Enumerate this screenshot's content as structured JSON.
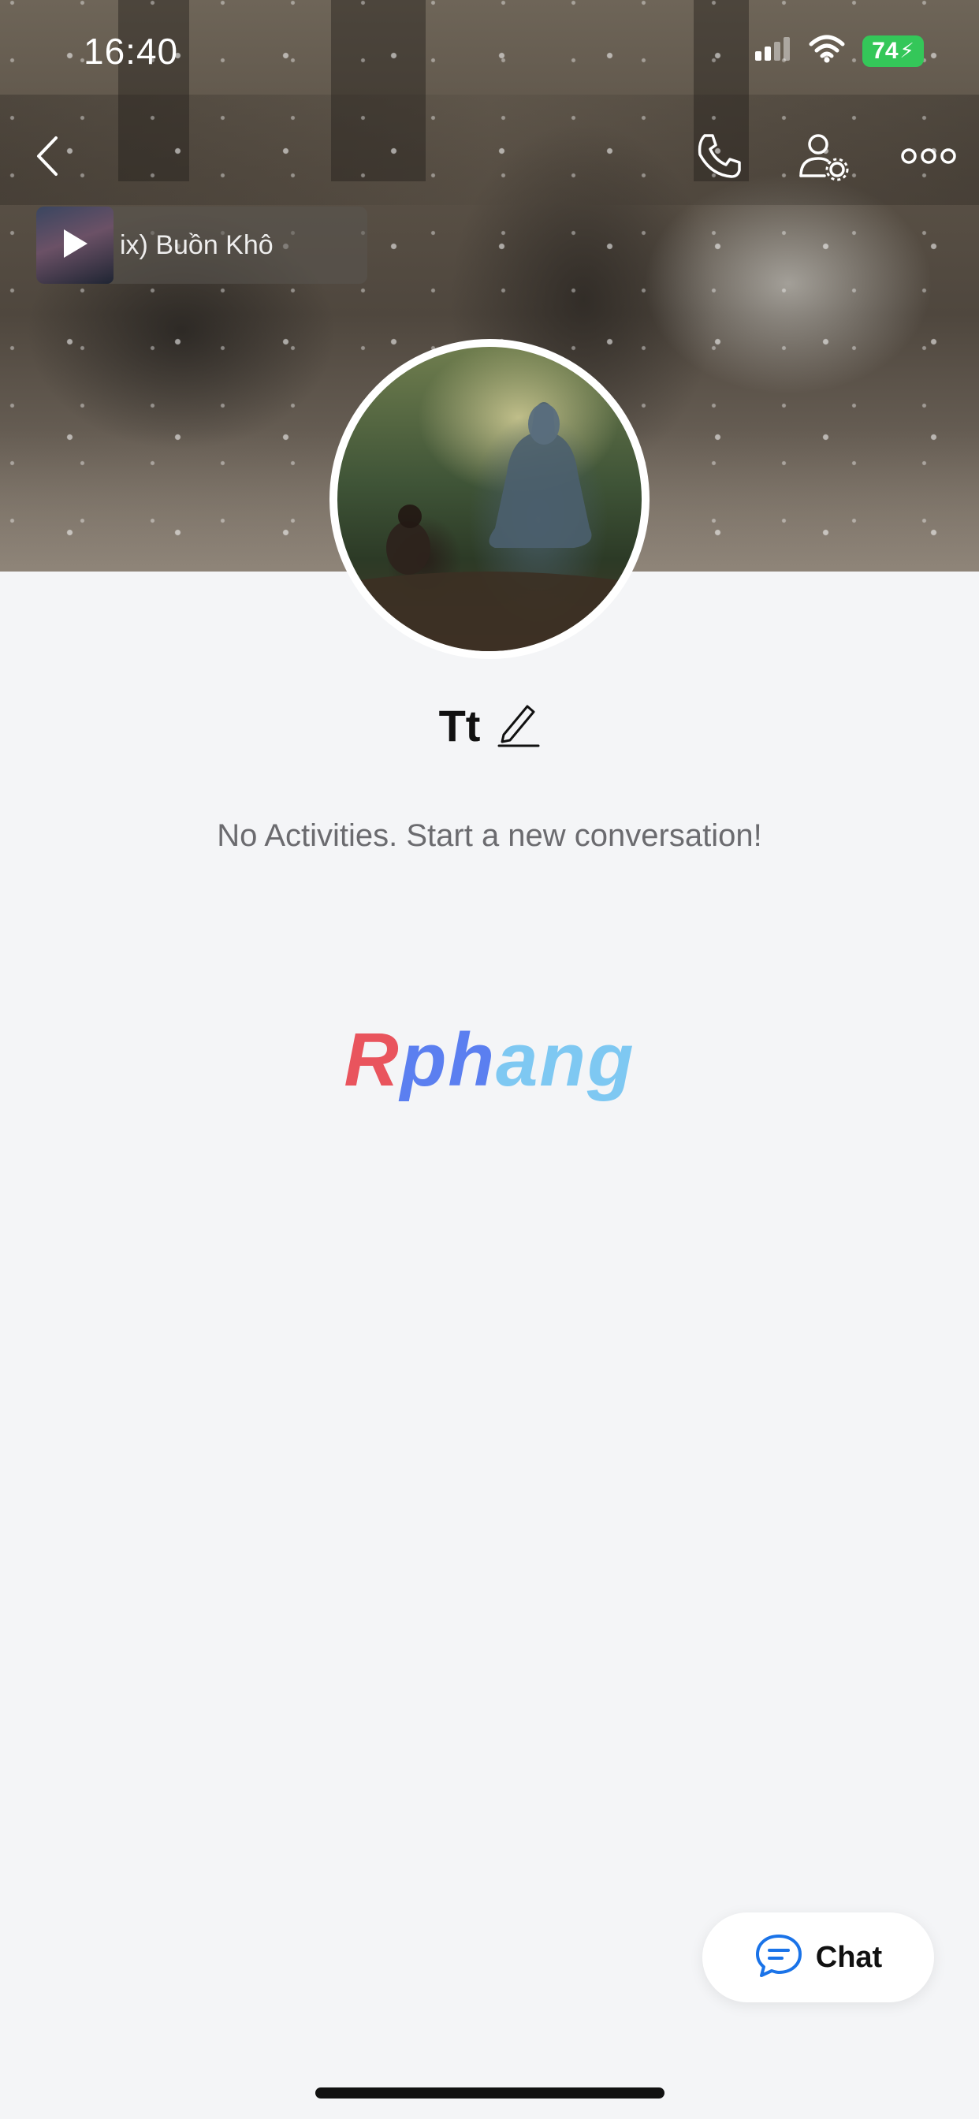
{
  "status_bar": {
    "time": "16:40",
    "battery": "74",
    "icons": [
      "signal-icon",
      "wifi-icon",
      "battery-charging-icon"
    ]
  },
  "header": {
    "back_icon": "chevron-left-icon",
    "call_icon": "phone-icon",
    "settings_icon": "user-settings-icon",
    "more_icon": "more-horizontal-icon"
  },
  "music": {
    "play_icon": "play-icon",
    "text": "ix)      Buồn Khô"
  },
  "profile": {
    "name": "Tt",
    "edit_icon": "pencil-icon"
  },
  "empty_state": {
    "message": "No Activities. Start a new conversation!"
  },
  "watermark": {
    "part1": "R",
    "part2": "ph",
    "part3": "ang"
  },
  "chat_button": {
    "icon": "chat-bubble-icon",
    "label": "Chat"
  },
  "colors": {
    "background": "#f4f5f7",
    "accent": "#1a73e8",
    "battery": "#34c759"
  }
}
